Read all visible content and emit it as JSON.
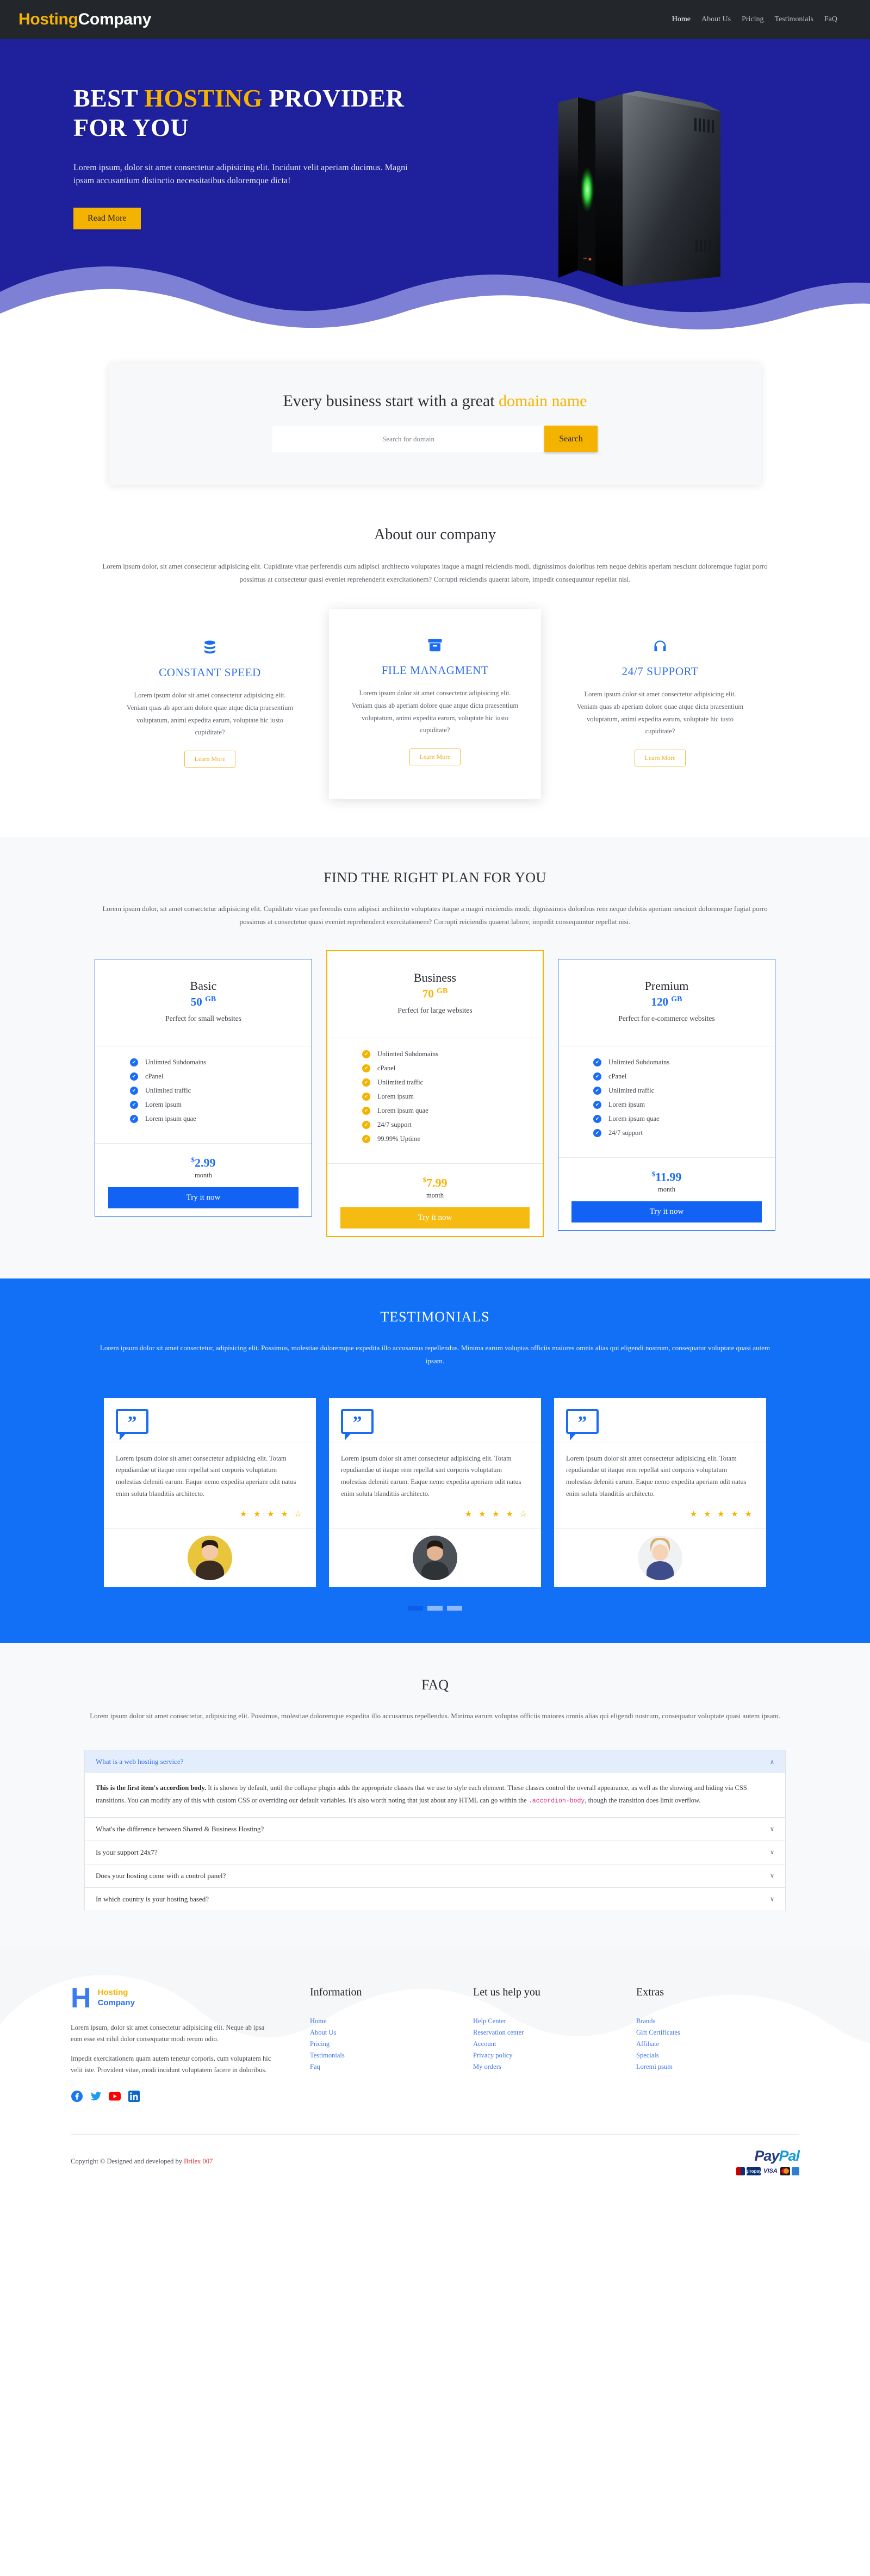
{
  "navbar": {
    "brand_1": "Hosting",
    "brand_2": "Company",
    "links": [
      {
        "label": "Home",
        "active": true
      },
      {
        "label": "About Us",
        "active": false
      },
      {
        "label": "Pricing",
        "active": false
      },
      {
        "label": "Testimonials",
        "active": false
      },
      {
        "label": "FaQ",
        "active": false
      }
    ]
  },
  "hero": {
    "title_1": "BEST ",
    "title_hl": "HOSTING",
    "title_2": " PROVIDER FOR YOU",
    "paragraph": "Lorem ipsum, dolor sit amet consectetur adipisicing elit. Incidunt velit aperiam ducimus. Magni ipsam accusantium distinctio necessitatibus doloremque dicta!",
    "button": "Read More",
    "bg_color": "#1f209b",
    "accent_color": "#f5b301"
  },
  "domain": {
    "heading_1": "Every business start with a great ",
    "heading_hl": "domain name",
    "placeholder": "Search for domain",
    "input_value": "",
    "search_button": "Search"
  },
  "about": {
    "heading": "About our company",
    "paragraph": "Lorem ipsum dolor, sit amet consectetur adipisicing elit. Cupiditate vitae perferendis cum adipisci architecto voluptates itaque a magni reiciendis modi, dignissimos doloribus rem neque debitis aperiam nesciunt doloremque fugiat porro possimus at consectetur quasi eveniet reprehenderit exercitationem? Corrupti reiciendis quaerat labore, impedit consequuntur repellat nisi."
  },
  "features": [
    {
      "icon": "database-icon",
      "title": "CONSTANT SPEED",
      "text": "Lorem ipsum dolor sit amet consectetur adipisicing elit. Veniam quas ab aperiam dolore quae atque dicta praesentium voluptatum, animi expedita earum, voluptate hic iusto cupiditate?",
      "button": "Learn More"
    },
    {
      "icon": "archive-box-icon",
      "title": "FILE MANAGMENT",
      "text": "Lorem ipsum dolor sit amet consectetur adipisicing elit. Veniam quas ab aperiam dolore quae atque dicta praesentium voluptatum, animi expedita earum, voluptate hic iusto cupiditate?",
      "button": "Learn More"
    },
    {
      "icon": "headset-icon",
      "title": "24/7 SUPPORT",
      "text": "Lorem ipsum dolor sit amet consectetur adipisicing elit. Veniam quas ab aperiam dolore quae atque dicta praesentium voluptatum, animi expedita earum, voluptate hic iusto cupiditate?",
      "button": "Learn More"
    }
  ],
  "pricing": {
    "heading": "FIND THE RIGHT PLAN FOR YOU",
    "paragraph": "Lorem ipsum dolor, sit amet consectetur adipisicing elit. Cupiditate vitae perferendis cum adipisci architecto voluptates itaque a magni reiciendis modi, dignissimos doloribus rem neque debitis aperiam nesciunt doloremque fugiat porro possimus at consectetur quasi eveniet reprehenderit exercitationem? Corrupti reiciendis quaerat labore, impedit consequuntur repellat nisi.",
    "plans": [
      {
        "name": "Basic",
        "size": "50",
        "size_unit": "GB",
        "desc": "Perfect for small websites",
        "features": [
          "Unlimted Subdomains",
          "cPanel",
          "Unlimited traffic",
          "Lorem ipsum",
          "Lorem ipsum quae"
        ],
        "currency": "$",
        "price": "2.99",
        "period": "month",
        "cta": "Try it now",
        "featured": false
      },
      {
        "name": "Business",
        "size": "70",
        "size_unit": "GB",
        "desc": "Perfect for large websites",
        "features": [
          "Unlimted Subdomains",
          "cPanel",
          "Unlimited traffic",
          "Lorem ipsum",
          "Lorem ipsum quae",
          "24/7 support",
          "99.99% Uptime"
        ],
        "currency": "$",
        "price": "7.99",
        "period": "month",
        "cta": "Try it now",
        "featured": true
      },
      {
        "name": "Premium",
        "size": "120",
        "size_unit": "GB",
        "desc": "Perfect for e-commerce websites",
        "features": [
          "Unlimted Subdomains",
          "cPanel",
          "Unlimited traffic",
          "Lorem ipsum",
          "Lorem ipsum quae",
          "24/7 support"
        ],
        "currency": "$",
        "price": "11.99",
        "period": "month",
        "cta": "Try it now",
        "featured": false
      }
    ]
  },
  "testimonials": {
    "heading": "TESTIMONIALS",
    "paragraph": "Lorem ipsum dolor sit amet consectetur, adipisicing elit. Possimus, molestiae doloremque expedita illo accusamus repellendus. Minima earum voluptas officiis maiores omnis alias qui eligendi nostrum, consequatur voluptate quasi autem ipsam.",
    "cards": [
      {
        "quote_icon": "quote-bubble-icon",
        "text": "Lorem ipsum dolor sit amet consectetur adipisicing elit. Totam repudiandae ut itaque rem repellat sint corporis voluptatum molestias deleniti earum. Eaque nemo expedita aperiam odit natus enim soluta blanditiis architecto.",
        "rating": "4.5",
        "stars": "★ ★ ★ ★ ☆",
        "avatar": "avatar-woman-dark-hair"
      },
      {
        "quote_icon": "quote-bubble-icon",
        "text": "Lorem ipsum dolor sit amet consectetur adipisicing elit. Totam repudiandae ut itaque rem repellat sint corporis voluptatum molestias deleniti earum. Eaque nemo expedita aperiam odit natus enim soluta blanditiis architecto.",
        "rating": "4.5",
        "stars": "★ ★ ★ ★ ☆",
        "avatar": "avatar-man"
      },
      {
        "quote_icon": "quote-bubble-icon",
        "text": "Lorem ipsum dolor sit amet consectetur adipisicing elit. Totam repudiandae ut itaque rem repellat sint corporis voluptatum molestias deleniti earum. Eaque nemo expedita aperiam odit natus enim soluta blanditiis architecto.",
        "rating": "5",
        "stars": "★ ★ ★ ★ ★",
        "avatar": "avatar-woman-blonde"
      }
    ],
    "dots": [
      {
        "active": true
      },
      {
        "active": false
      },
      {
        "active": false
      }
    ]
  },
  "faq": {
    "heading": "FAQ",
    "paragraph": "Lorem ipsum dolor sit amet consectetur, adipisicing elit. Possimus, molestiae doloremque expedita illo accusamus repellendus. Minima earum voluptas officiis maiores omnis alias qui eligendi nostrum, consequatur voluptate quasi autem ipsam.",
    "items": [
      {
        "question": "What is a web hosting service?",
        "open": true,
        "chevron": "chevron-up-icon",
        "body_bold": "This is the first item's accordion body.",
        "body_1": " It is shown by default, until the collapse plugin adds the appropriate classes that we use to style each element. These classes control the overall appearance, as well as the showing and hiding via CSS transitions. You can modify any of this with custom CSS or overriding our default variables. It's also worth noting that just about any HTML can go within the ",
        "body_code": ".accordion-body",
        "body_2": ", though the transition does limit overflow."
      },
      {
        "question": "What's the difference between Shared & Business Hosting?",
        "open": false,
        "chevron": "chevron-down-icon"
      },
      {
        "question": "Is your support 24x7?",
        "open": false,
        "chevron": "chevron-down-icon"
      },
      {
        "question": "Does your hosting come with a control panel?",
        "open": false,
        "chevron": "chevron-down-icon"
      },
      {
        "question": "In which country is your hosting based?",
        "open": false,
        "chevron": "chevron-down-icon"
      }
    ]
  },
  "footer": {
    "logo_letter": "H",
    "logo_1": "Hosting",
    "logo_2": "Company",
    "about_p1": "Lorem ipsum, dolor sit amet consectetur adipisicing elit. Neque ab ipsa eum esse est nihil dolor consequatur modi rerum odio.",
    "about_p2": "Impedit exercitationem quam autem tenetur corporis, cum voluptatem hic velit iste. Provident vitae, modi incidunt voluptatem facere in doloribus.",
    "socials": [
      {
        "name": "facebook-icon"
      },
      {
        "name": "twitter-icon"
      },
      {
        "name": "youtube-icon"
      },
      {
        "name": "linkedin-icon"
      }
    ],
    "columns": [
      {
        "title": "Information",
        "links": [
          "Home",
          "About Us",
          "Pricing",
          "Testimonials",
          "Faq"
        ]
      },
      {
        "title": "Let us help you",
        "links": [
          "Help Center",
          "Reservation center",
          "Account",
          "Privacy policy",
          "My orders"
        ]
      },
      {
        "title": "Extras",
        "links": [
          "Brands",
          "Gift Certificates",
          "Affiliate",
          "Specials",
          "Loremi psum"
        ]
      }
    ],
    "copyright_text": "Copyright © Designed and developed by ",
    "copyright_dev": "Brilex 007",
    "paypal_1": "Pay",
    "paypal_2": "Pal",
    "paypal_cards": [
      "",
      "giropay",
      "VISA",
      "MC",
      ""
    ]
  }
}
